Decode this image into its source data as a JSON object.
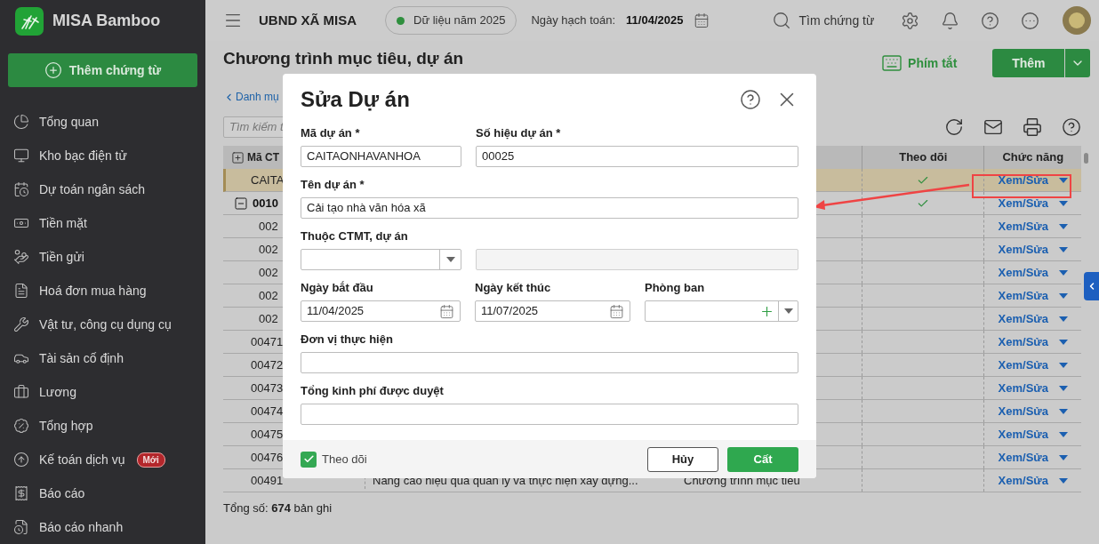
{
  "app": {
    "name": "MISA Bamboo",
    "add_voucher": "Thêm chứng từ"
  },
  "sidebar": {
    "items": [
      {
        "label": "Tổng quan"
      },
      {
        "label": "Kho bạc điện tử"
      },
      {
        "label": "Dự toán ngân sách"
      },
      {
        "label": "Tiền mặt"
      },
      {
        "label": "Tiền gửi"
      },
      {
        "label": "Hoá đơn mua hàng"
      },
      {
        "label": "Vật tư, công cụ dụng cụ"
      },
      {
        "label": "Tài sản cố định"
      },
      {
        "label": "Lương"
      },
      {
        "label": "Tổng hợp"
      },
      {
        "label": "Kế toán dịch vụ",
        "badge": "Mới"
      },
      {
        "label": "Báo cáo"
      },
      {
        "label": "Báo cáo nhanh"
      }
    ]
  },
  "topbar": {
    "org": "UBND XÃ MISA",
    "data_year": "Dữ liệu năm 2025",
    "posting_date_label": "Ngày hạch toán:",
    "posting_date": "11/04/2025",
    "search": "Tìm chứng từ"
  },
  "page": {
    "title": "Chương trình mục tiêu, dự án",
    "breadcrumb": "Danh mụ",
    "shortcut": "Phím tắt",
    "add": "Thêm",
    "search_placeholder": "Tìm kiếm t"
  },
  "table": {
    "columns": {
      "code": "Mã CT",
      "follow": "Theo dõi",
      "actions": "Chức năng"
    },
    "rows": [
      {
        "code": "CAITA",
        "selected": true,
        "followed": true,
        "action": "Xem/Sửa"
      },
      {
        "code": "0010",
        "selected": false,
        "followed": true,
        "action": "Xem/Sửa",
        "expanded": true,
        "children": [
          {
            "code": "002",
            "selected": false,
            "followed": false,
            "action": "Xem/Sửa"
          },
          {
            "code": "002",
            "selected": false,
            "followed": false,
            "action": "Xem/Sửa"
          },
          {
            "code": "002",
            "selected": false,
            "followed": false,
            "action": "Xem/Sửa"
          },
          {
            "code": "002",
            "selected": false,
            "followed": false,
            "action": "Xem/Sửa"
          },
          {
            "code": "002",
            "selected": false,
            "followed": false,
            "action": "Xem/Sửa"
          }
        ]
      },
      {
        "code": "00471",
        "selected": false,
        "followed": false,
        "action": "Xem/Sửa"
      },
      {
        "code": "00472",
        "selected": false,
        "followed": false,
        "action": "Xem/Sửa"
      },
      {
        "code": "00473",
        "selected": false,
        "followed": false,
        "action": "Xem/Sửa"
      },
      {
        "code": "00474",
        "selected": false,
        "followed": false,
        "action": "Xem/Sửa"
      },
      {
        "code": "00475",
        "selected": false,
        "followed": false,
        "action": "Xem/Sửa"
      },
      {
        "code": "00476",
        "selected": false,
        "followed": false,
        "action": "Xem/Sửa"
      },
      {
        "code": "00491",
        "name": "Nâng cao hiệu quả quản lý và thực hiện xây dựng...",
        "category": "Chương trình mục tiêu",
        "selected": false,
        "followed": false,
        "action": "Xem/Sửa"
      }
    ]
  },
  "footer": {
    "total": "Tổng số: **674** bản ghi"
  },
  "dialog": {
    "title": "Sửa Dự án",
    "project_code": {
      "label": "Mã dự án *",
      "value": "CAITAONHAVANHOA"
    },
    "project_number": {
      "label": "Số hiệu dự án *",
      "value": "00025"
    },
    "project_name": {
      "label": "Tên dự án *",
      "value": "Cải tạo nhà văn hóa xã"
    },
    "parent_program": {
      "label": "Thuộc CTMT, dự án"
    },
    "start_date": {
      "label": "Ngày bắt đầu",
      "value": "11/04/2025"
    },
    "end_date": {
      "label": "Ngày kết thúc",
      "value": "11/07/2025"
    },
    "department": {
      "label": "Phòng ban"
    },
    "executing_unit": {
      "label": "Đơn vị thực hiện"
    },
    "approved_budget": {
      "label": "Tổng kinh phí được duyệt"
    },
    "follow": {
      "label": "Theo dõi",
      "checked": true
    },
    "buttons": {
      "cancel": "Hủy",
      "save": "Cất"
    }
  }
}
